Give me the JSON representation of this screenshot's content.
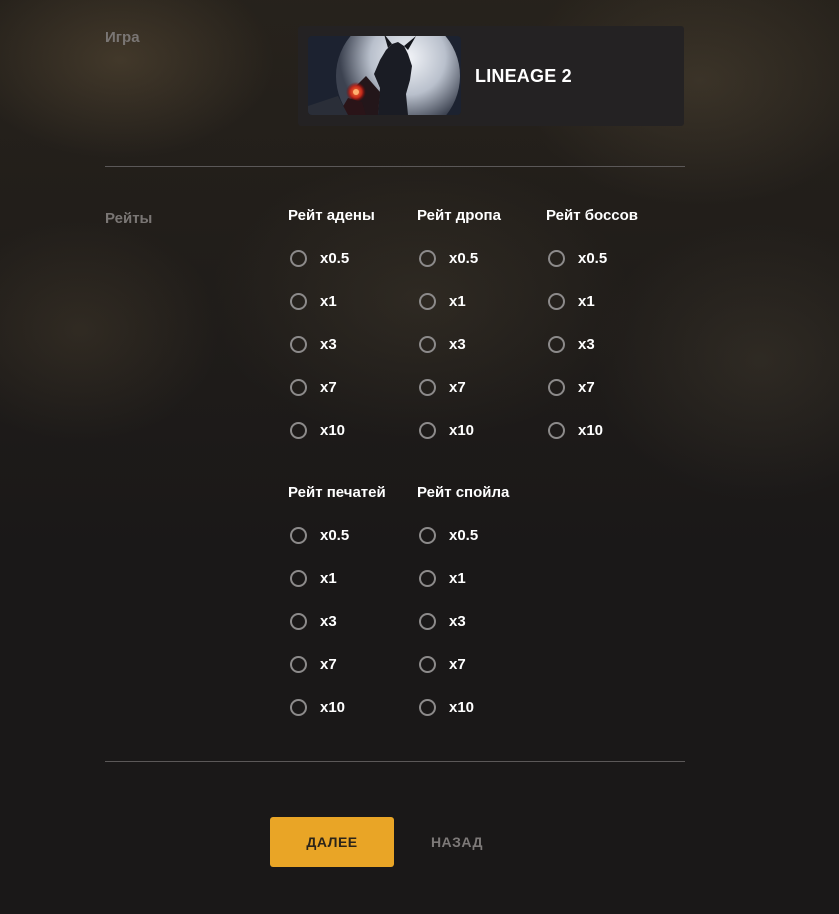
{
  "game_section": {
    "label": "Игра",
    "selected_game": {
      "title": "LINEAGE 2",
      "thumbnail": "lineage2-dark-elf-warrior-image"
    }
  },
  "rates_section": {
    "label": "Рейты",
    "groups": [
      {
        "title": "Рейт адены",
        "options": [
          "x0.5",
          "x1",
          "x3",
          "x7",
          "x10"
        ]
      },
      {
        "title": "Рейт дропа",
        "options": [
          "x0.5",
          "x1",
          "x3",
          "x7",
          "x10"
        ]
      },
      {
        "title": "Рейт боссов",
        "options": [
          "x0.5",
          "x1",
          "x3",
          "x7",
          "x10"
        ]
      },
      {
        "title": "Рейт печатей",
        "options": [
          "x0.5",
          "x1",
          "x3",
          "x7",
          "x10"
        ]
      },
      {
        "title": "Рейт спойла",
        "options": [
          "x0.5",
          "x1",
          "x3",
          "x7",
          "x10"
        ]
      }
    ]
  },
  "actions": {
    "next_label": "ДАЛЕЕ",
    "back_label": "НАЗАД"
  },
  "colors": {
    "accent": "#e9a526",
    "background": "#1a1818",
    "card": "#242223",
    "muted_text": "#7a7674"
  }
}
